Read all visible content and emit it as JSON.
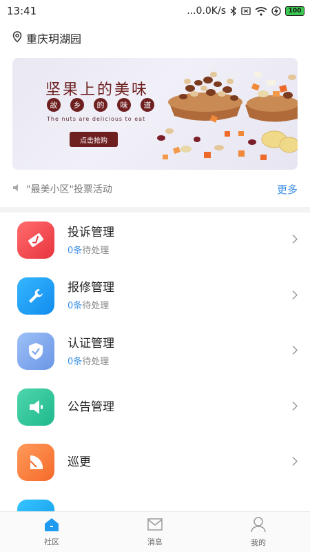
{
  "status_bar": {
    "time": "13:41",
    "network_speed": "...0.0K/s",
    "battery": "100",
    "icons": [
      "bluetooth-icon",
      "sim-icon",
      "wifi-icon",
      "charging-icon",
      "battery-icon"
    ]
  },
  "location": {
    "icon": "location-pin-icon",
    "name": "重庆玥湖园"
  },
  "banner": {
    "title": "坚果上的美味",
    "chips": [
      "故",
      "乡",
      "的",
      "味",
      "道"
    ],
    "subtitle": "The nuts are delicious to eat",
    "button_label": "点击抢购"
  },
  "notice": {
    "icon": "speaker-icon",
    "text": "\"最美小区\"投票活动",
    "more_label": "更多"
  },
  "menu": [
    {
      "title": "投诉管理",
      "count": "0条",
      "status": "待处理",
      "icon": "complaint-icon",
      "color": "#f0454b"
    },
    {
      "title": "报修管理",
      "count": "0条",
      "status": "待处理",
      "icon": "wrench-icon",
      "color": "#1e9af0"
    },
    {
      "title": "认证管理",
      "count": "0条",
      "status": "待处理",
      "icon": "shield-check-icon",
      "color": "#7aa6ea"
    },
    {
      "title": "公告管理",
      "count": "",
      "status": "",
      "icon": "announcement-icon",
      "color": "#2fc29a"
    },
    {
      "title": "巡更",
      "count": "",
      "status": "",
      "icon": "patrol-icon",
      "color": "#fb7a3a"
    }
  ],
  "tab_bar": [
    {
      "label": "社区",
      "icon": "home-icon",
      "active": true,
      "color": "#1e9af0"
    },
    {
      "label": "消息",
      "icon": "mail-icon",
      "active": false
    },
    {
      "label": "我的",
      "icon": "user-icon",
      "active": false
    }
  ]
}
